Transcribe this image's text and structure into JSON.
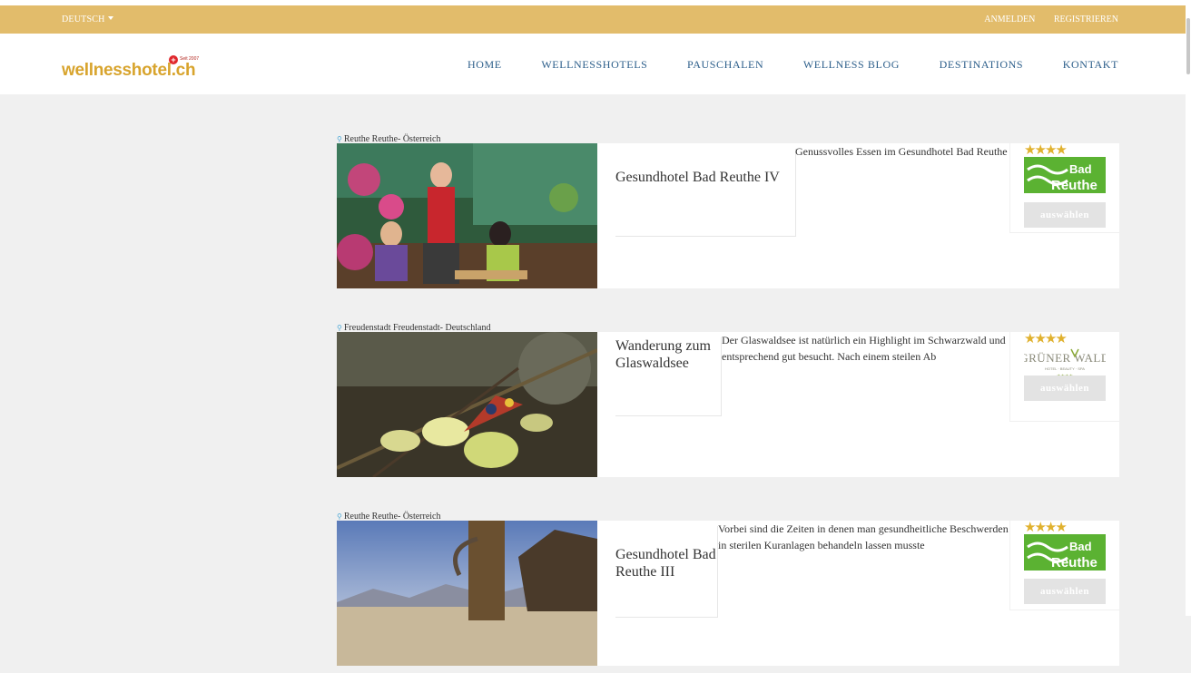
{
  "topbar": {
    "language": "DEUTSCH",
    "login": "ANMELDEN",
    "register": "REGISTRIEREN"
  },
  "brand": {
    "logo_text": "wellnesshotel.ch",
    "since": "Seit 2007"
  },
  "nav": [
    "HOME",
    "WELLNESSHOTELS",
    "PAUSCHALEN",
    "WELLNESS BLOG",
    "DESTINATIONS",
    "KONTAKT"
  ],
  "colors": {
    "topbar": "#e2bc6b",
    "nav_link": "#2d5f8b",
    "logo_gold": "#d8a42d",
    "star": "#e0b12e",
    "button_bg": "#e3e3e3"
  },
  "listings": [
    {
      "location": "Reuthe Reuthe- Österreich",
      "title": "Gesundhotel Bad Reuthe IV",
      "description": "Genussvolles Essen im Gesundhotel Bad Reuthe",
      "stars": "★★★★",
      "hotel_logo": "Bad Reuthe",
      "button": "auswählen",
      "photo": "woman serving guests at outdoor table"
    },
    {
      "location": "Freudenstadt Freudenstadt- Deutschland",
      "title": "Wanderung zum Glaswaldsee",
      "description": "Der Glaswaldsee ist natürlich ein Highlight im Schwarzwald und entsprechend gut besucht. Nach einem steilen Ab",
      "stars": "★★★★",
      "hotel_logo": "GRÜNER WALD",
      "hotel_logo_sub": "HOTEL · BEAUTY · SPA",
      "button": "auswählen",
      "photo": "butterfly on willow catkins"
    },
    {
      "location": "Reuthe Reuthe- Österreich",
      "title": "Gesundhotel Bad Reuthe III",
      "description": "Vorbei sind die Zeiten in denen man gesundheitliche Beschwerden in sterilen Kuranlagen behandeln lassen musste",
      "stars": "★★★★",
      "hotel_logo": "Bad Reuthe",
      "button": "auswählen",
      "photo": "mountain view with wooden fountain"
    }
  ]
}
